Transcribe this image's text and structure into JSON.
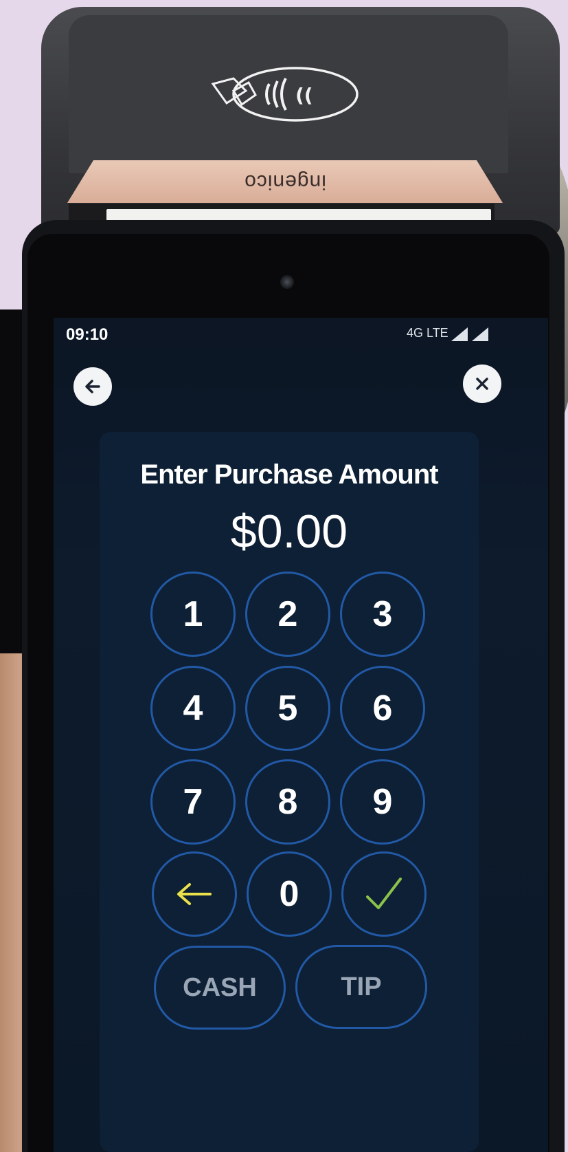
{
  "device": {
    "brand": "ingenico",
    "nfc_symbol": "contactless-payment-icon"
  },
  "status_bar": {
    "time": "09:10",
    "network": "4G LTE",
    "signal_icons": [
      "signal-icon",
      "roaming-signal-icon"
    ]
  },
  "nav": {
    "back_icon": "arrow-left-icon",
    "close_icon": "close-icon"
  },
  "screen": {
    "title": "Enter Purchase Amount",
    "amount": "$0.00"
  },
  "keypad": {
    "keys": [
      "1",
      "2",
      "3",
      "4",
      "5",
      "6",
      "7",
      "8",
      "9"
    ],
    "zero": "0",
    "backspace_icon": "arrow-left-icon",
    "confirm_icon": "checkmark-icon",
    "cash_label": "CASH",
    "tip_label": "TIP"
  },
  "colors": {
    "key_border": "#2259a6",
    "backspace_accent": "#e9e24a",
    "confirm_accent": "#8bc34a",
    "muted_label": "#9aa6b6"
  }
}
